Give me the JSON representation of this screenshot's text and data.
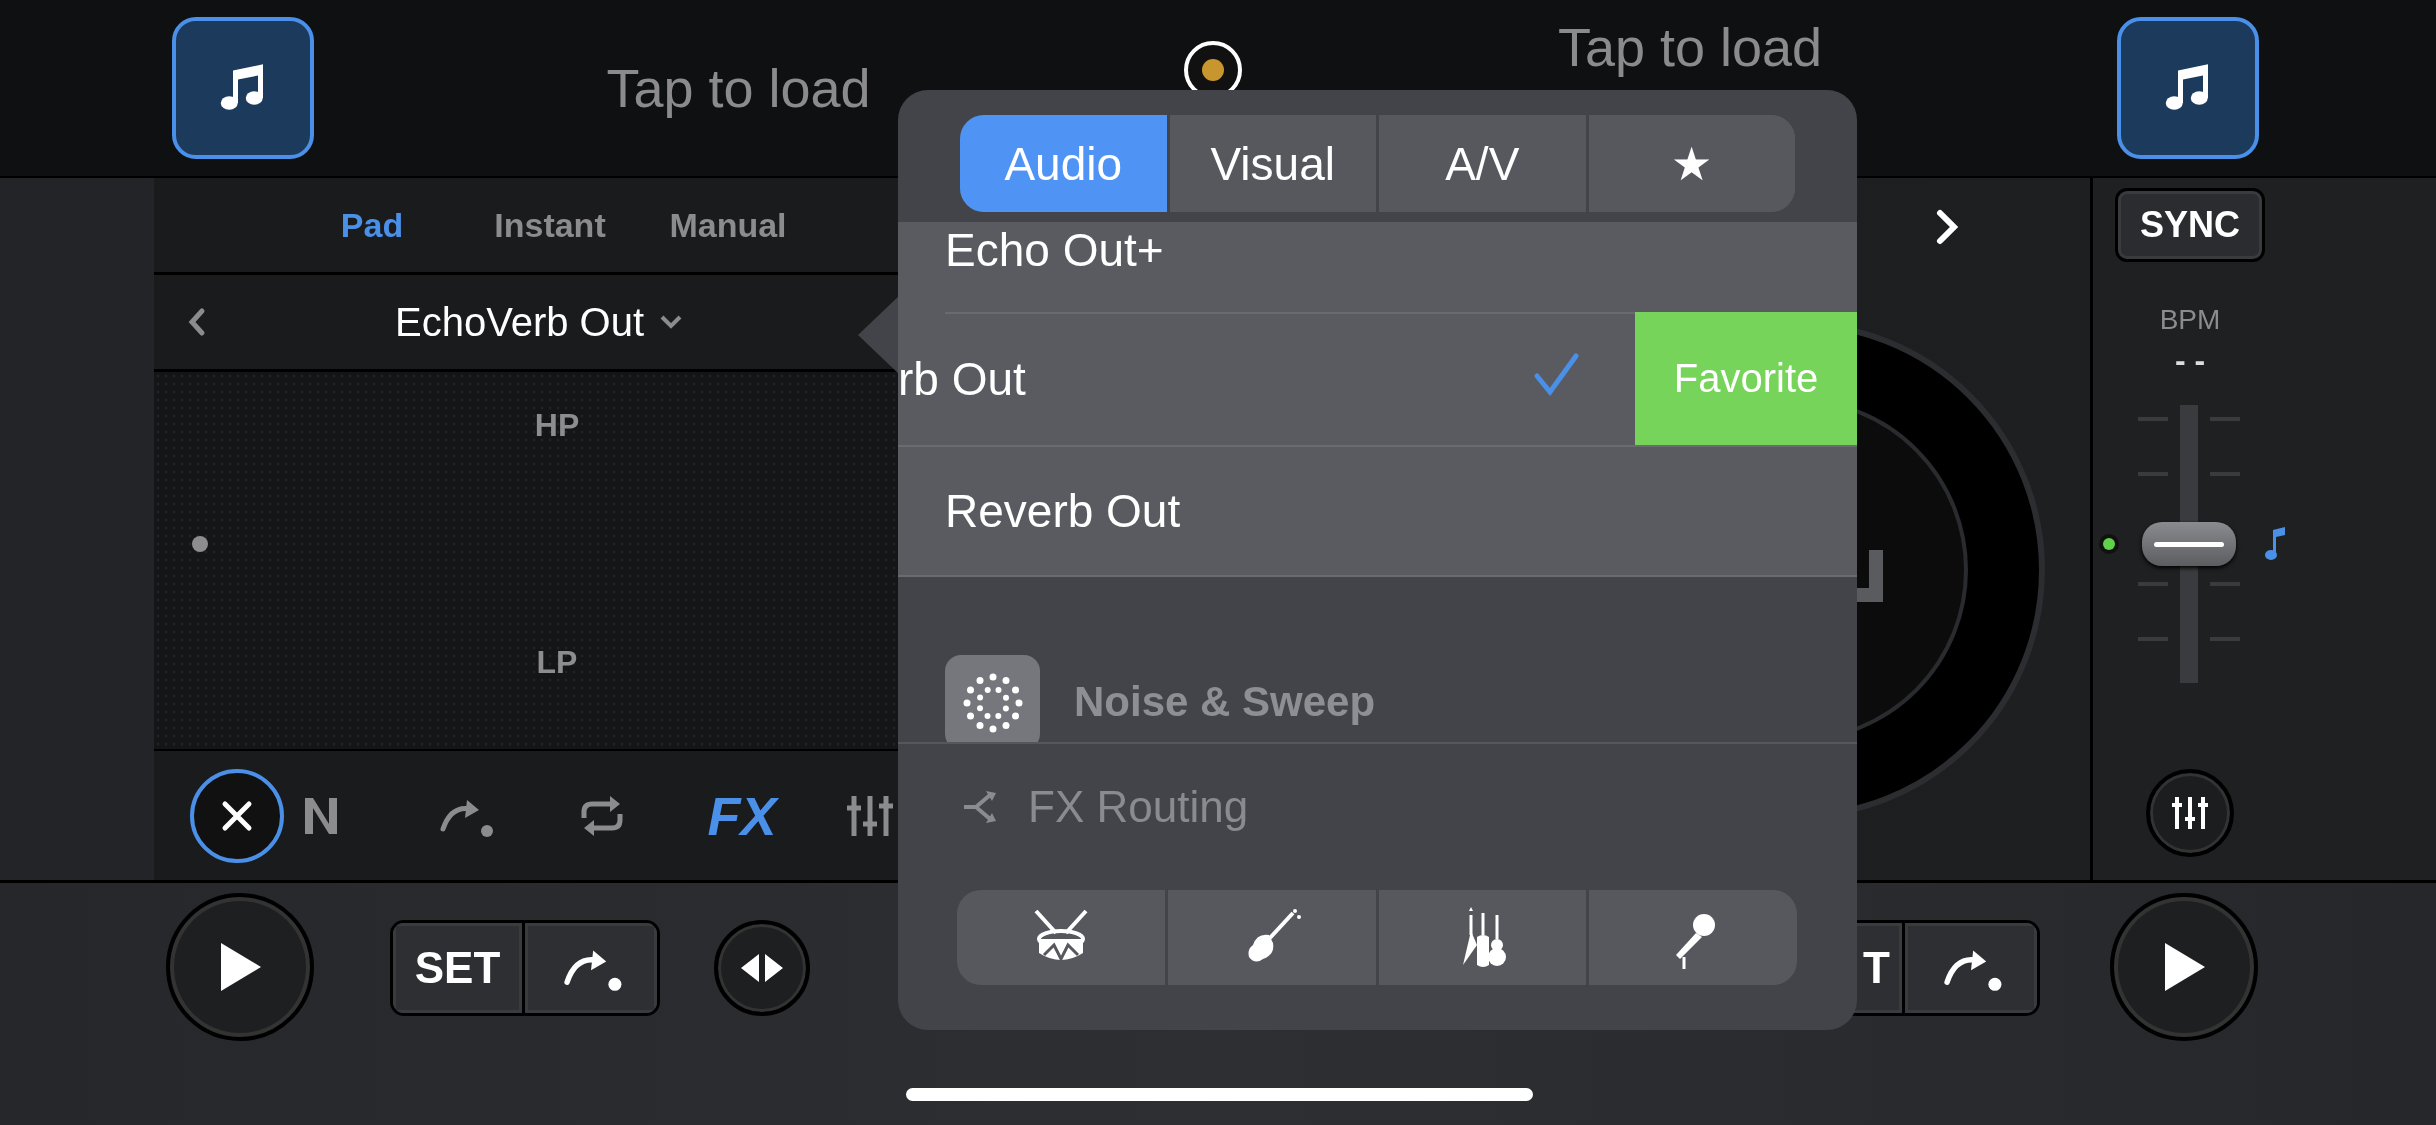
{
  "top_bar": {
    "decks": [
      {
        "load_text": "Tap to load"
      },
      {
        "load_text": "Tap to load"
      }
    ]
  },
  "fx_panel": {
    "modes": [
      {
        "label": "Pad",
        "selected": true
      },
      {
        "label": "Instant",
        "selected": false
      },
      {
        "label": "Manual",
        "selected": false
      }
    ],
    "effect_name": "EchoVerb Out",
    "pad": {
      "top_label": "HP",
      "bottom_label": "LP"
    },
    "toolbar": [
      {
        "kind": "close",
        "selected": false
      },
      {
        "kind": "n-logo",
        "selected": false
      },
      {
        "kind": "cue-jump",
        "selected": false
      },
      {
        "kind": "loop",
        "selected": false
      },
      {
        "kind": "fx",
        "label": "FX",
        "selected": true
      },
      {
        "kind": "mixer",
        "selected": false
      }
    ]
  },
  "sync_panel": {
    "sync_label": "SYNC",
    "bpm_label": "BPM",
    "bpm_value": "- -",
    "pitch": {
      "level": 0.5
    }
  },
  "transport": {
    "left": {
      "set_label": "SET"
    },
    "right": {
      "set_label": "T"
    }
  },
  "effect_popover": {
    "tabs": [
      {
        "label": "Audio",
        "selected": true
      },
      {
        "label": "Visual",
        "selected": false
      },
      {
        "label": "A/V",
        "selected": false
      },
      {
        "label": "★",
        "selected": false
      }
    ],
    "effects": [
      {
        "label": "Echo Out+",
        "checked": false,
        "swiped": false
      },
      {
        "label": "rb Out",
        "checked": true,
        "swiped": true,
        "action": "Favorite"
      },
      {
        "label": "Reverb Out",
        "checked": false,
        "swiped": false
      }
    ],
    "category": {
      "label": "Noise & Sweep"
    },
    "routing_label": "FX Routing",
    "routing_targets": [
      {
        "kind": "drums"
      },
      {
        "kind": "bass"
      },
      {
        "kind": "guitars"
      },
      {
        "kind": "vocals"
      }
    ]
  }
}
